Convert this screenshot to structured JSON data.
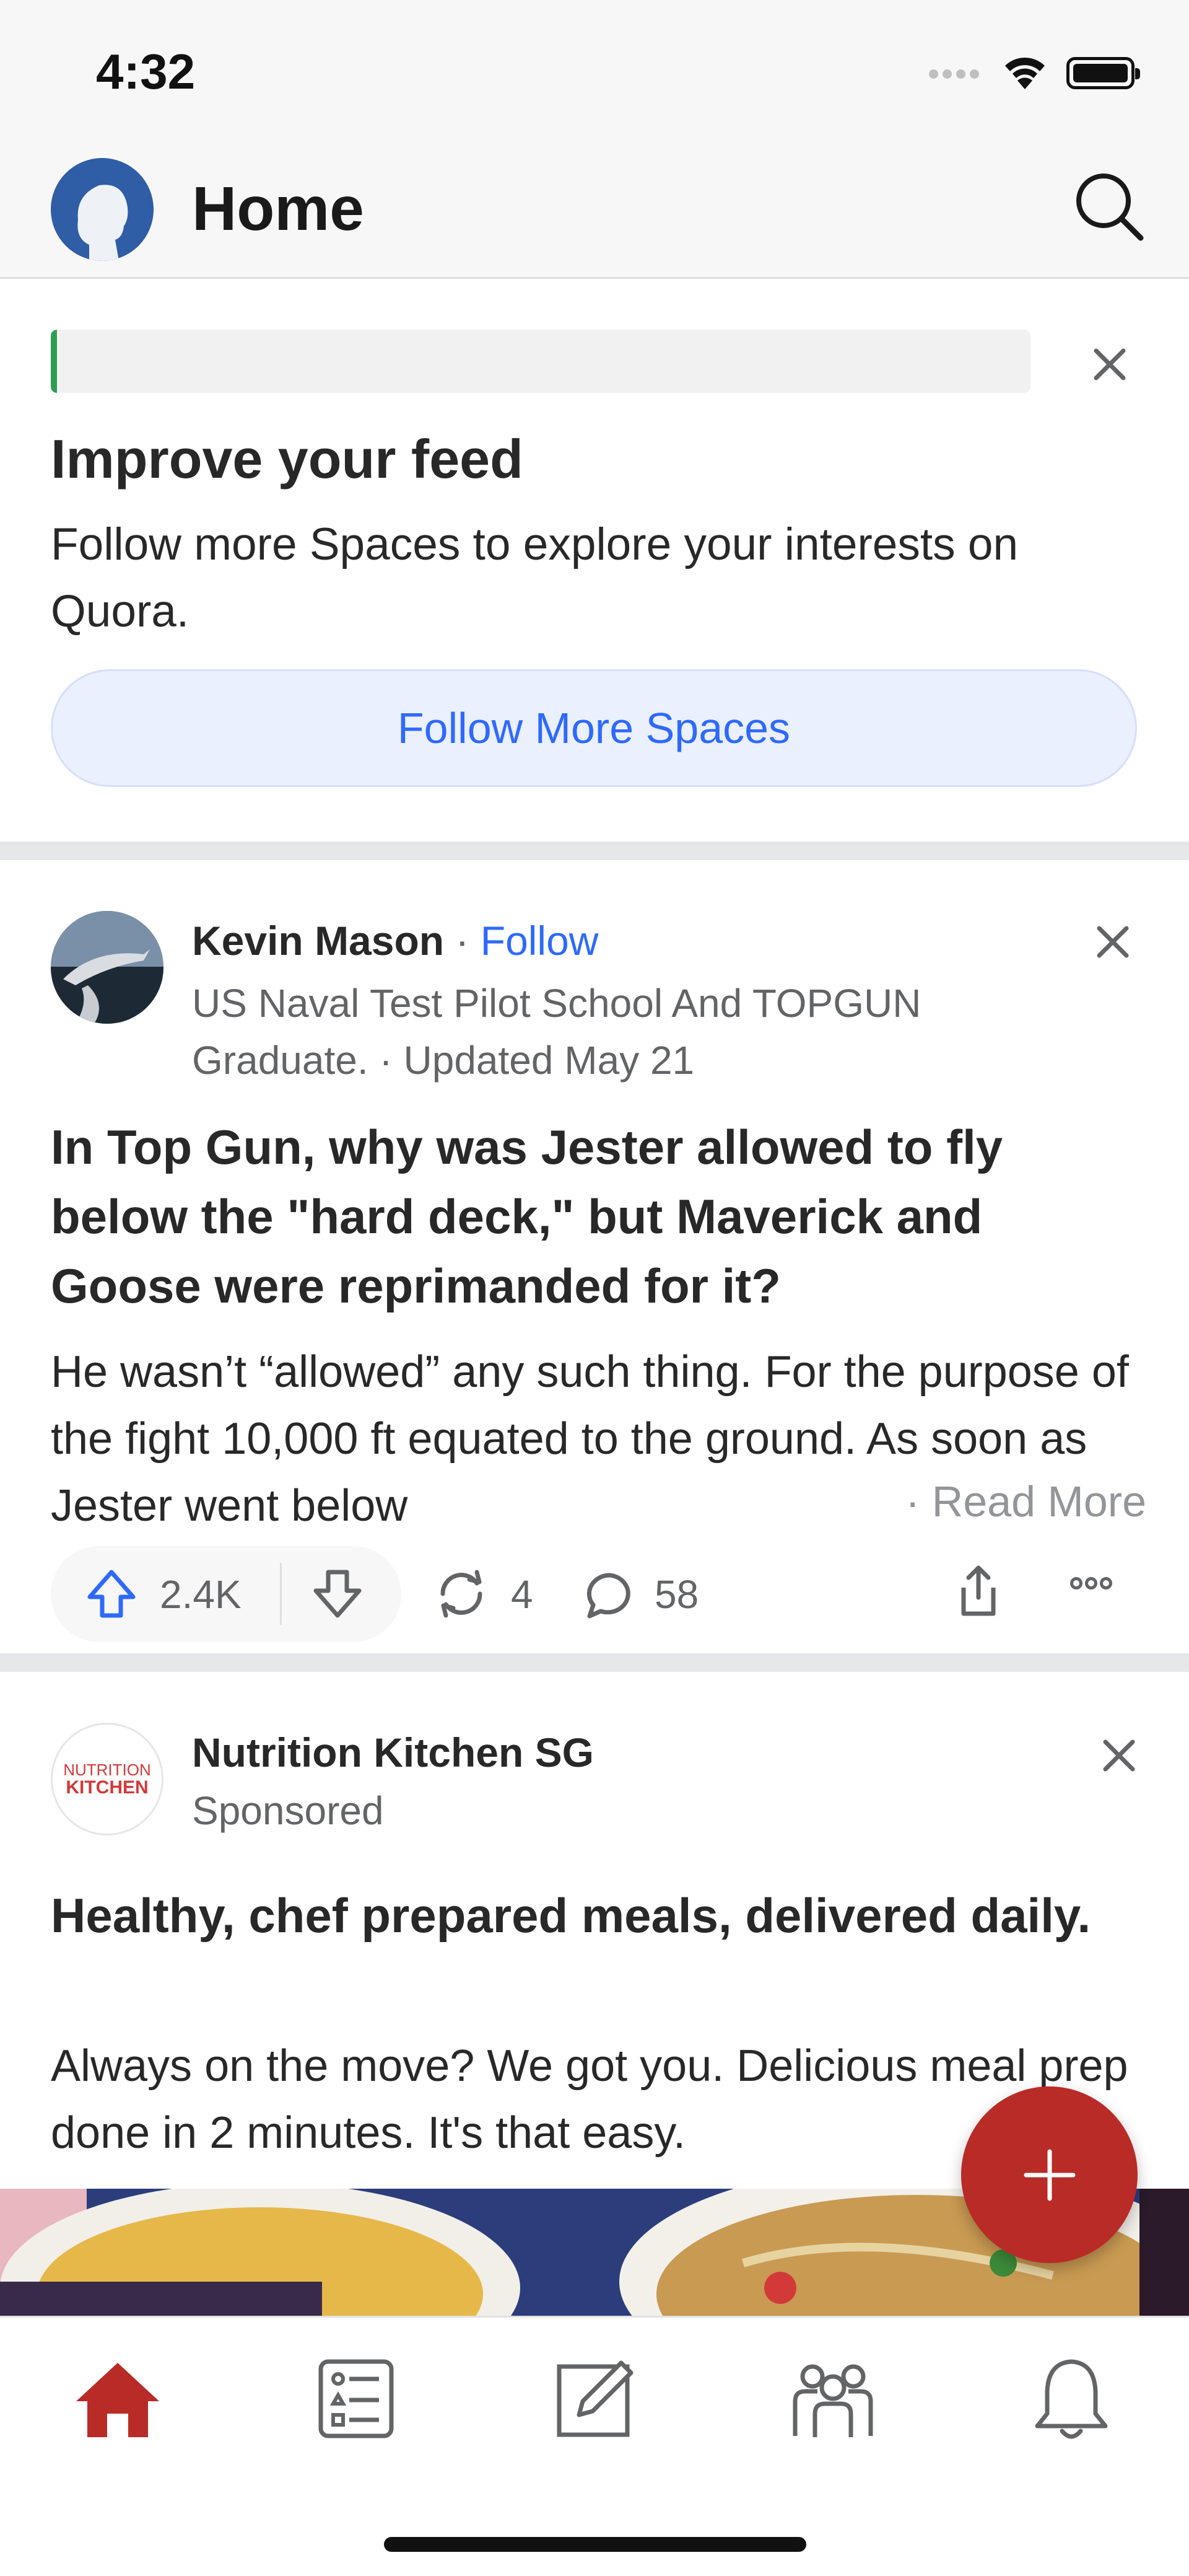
{
  "status_bar": {
    "time": "4:32"
  },
  "header": {
    "title": "Home"
  },
  "improve_feed": {
    "progress": 0.006,
    "title": "Improve your feed",
    "description": "Follow more Spaces to explore your interests on Quora.",
    "button_label": "Follow More Spaces"
  },
  "post": {
    "author": "Kevin Mason",
    "separator": " · ",
    "follow_label": "Follow",
    "credential": "US Naval Test Pilot School And TOPGUN Graduate. · Updated May 21",
    "question": "In Top Gun, why was Jester allowed to fly below the \"hard deck,\" but Maverick and Goose were reprimanded for it?",
    "body": "He wasn’t “allowed” any such thing. For the purpose of the fight 10,000 ft equated to the ground. As soon as Jester went below",
    "read_more": "· Read More",
    "upvotes": "2.4K",
    "shares": "4",
    "comments": "58"
  },
  "ad": {
    "avatar_line1": "NUTRITION",
    "avatar_line2": "KITCHEN",
    "name": "Nutrition Kitchen SG",
    "sponsored": "Sponsored",
    "headline": "Healthy, chef prepared meals, delivered daily.",
    "body": "Always on the move? We got you. Delicious meal prep done in 2 minutes. It's that easy."
  },
  "bottom_nav": {
    "items": [
      {
        "name": "home",
        "icon": "home-icon",
        "active": true
      },
      {
        "name": "following",
        "icon": "list-icon",
        "active": false
      },
      {
        "name": "answer",
        "icon": "edit-icon",
        "active": false
      },
      {
        "name": "spaces",
        "icon": "people-icon",
        "active": false
      },
      {
        "name": "notifications",
        "icon": "bell-icon",
        "active": false
      }
    ]
  },
  "colors": {
    "brand_red": "#b92b27",
    "link_blue": "#2e69ff",
    "progress_green": "#2e9e53",
    "muted_text": "#636466"
  }
}
